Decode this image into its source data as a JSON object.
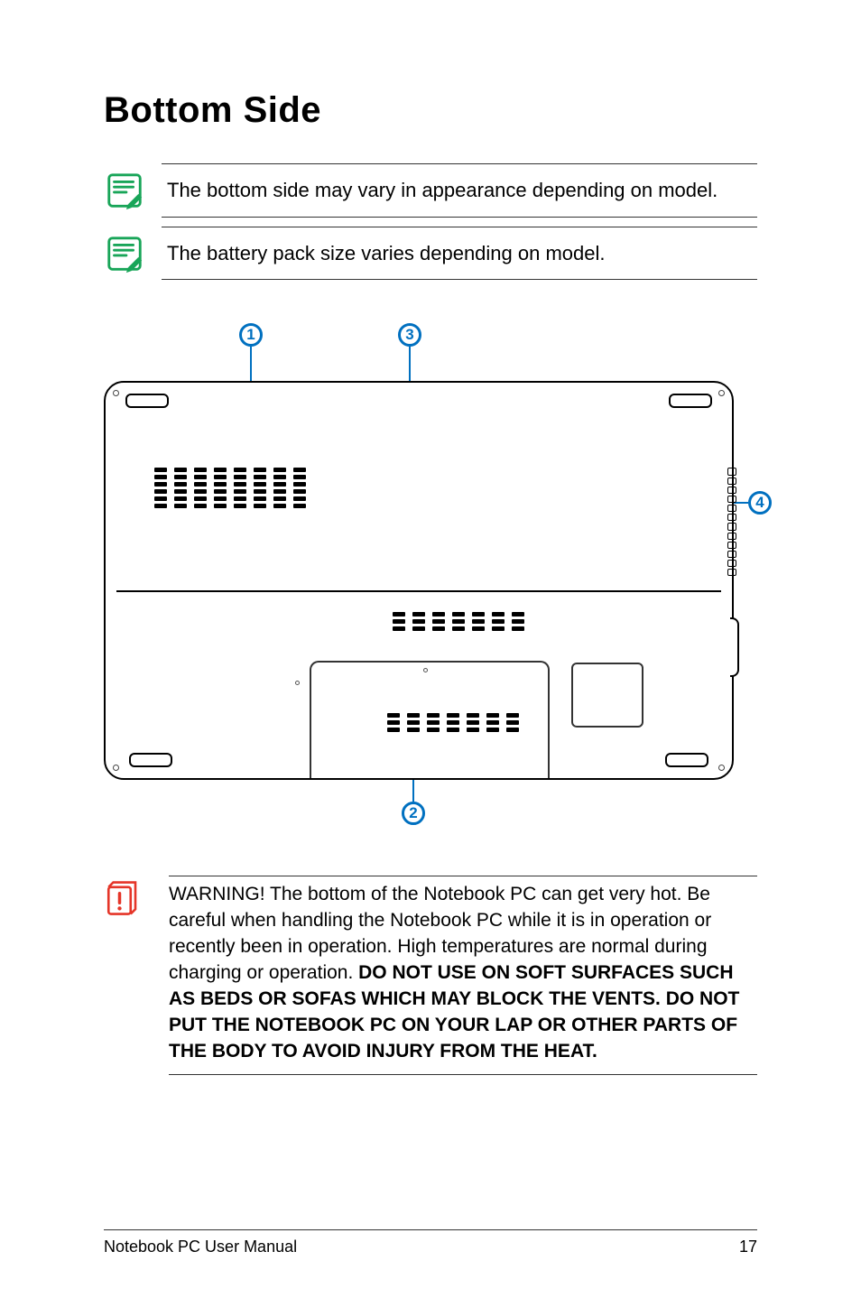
{
  "title": "Bottom Side",
  "notes": [
    "The bottom side may vary in appearance depending on model.",
    "The battery pack size varies depending on model."
  ],
  "callouts": {
    "c1": "1",
    "c2": "2",
    "c3": "3",
    "c4": "4"
  },
  "warning": {
    "lead": "WARNING!  The bottom of the Notebook PC can get very hot. Be careful when handling the Notebook PC while it is in operation or recently been in operation. High temperatures are normal during charging or operation. ",
    "bold": "DO NOT USE ON SOFT SURFACES SUCH AS BEDS OR SOFAS WHICH MAY BLOCK THE VENTS. DO NOT PUT THE NOTEBOOK PC ON YOUR LAP OR OTHER PARTS OF THE BODY TO AVOID INJURY FROM THE HEAT."
  },
  "footer": {
    "left": "Notebook PC User Manual",
    "page": "17"
  }
}
